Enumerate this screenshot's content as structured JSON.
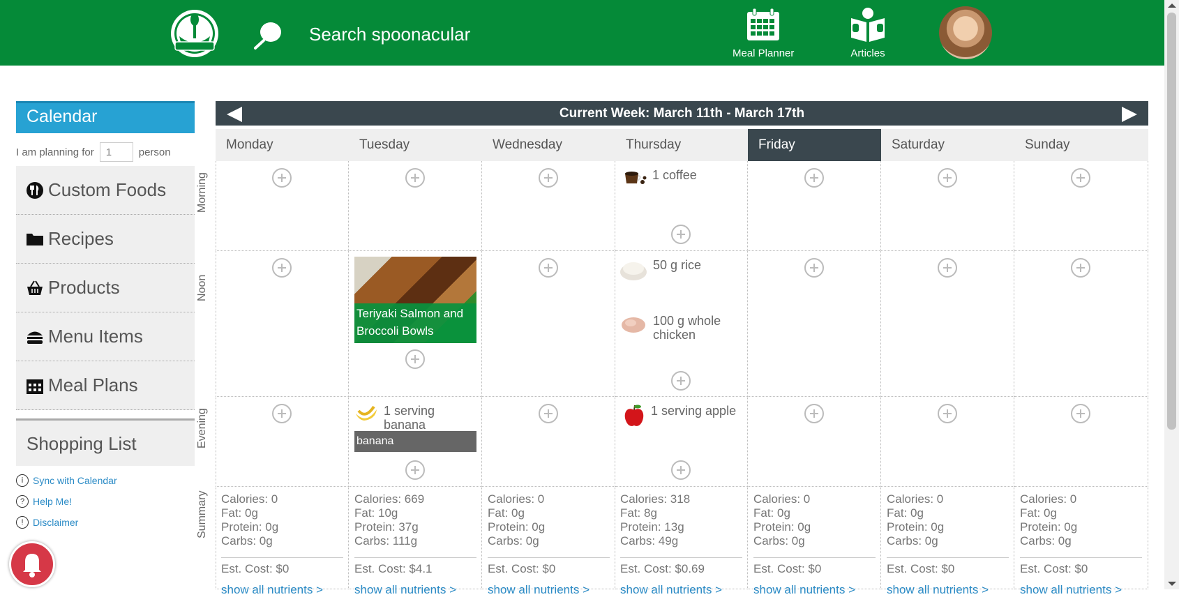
{
  "header": {
    "search_placeholder": "Search spoonacular",
    "nav": [
      {
        "label": "Meal Planner",
        "icon": "calendar-icon"
      },
      {
        "label": "Articles",
        "icon": "book-reader-icon"
      }
    ],
    "colors": {
      "brand": "#058a38",
      "accent": "#27a2d3"
    }
  },
  "sidebar": {
    "calendar_label": "Calendar",
    "planning_prefix": "I am planning for",
    "planning_value": "1",
    "planning_suffix": "person",
    "items": [
      {
        "label": "Custom Foods",
        "icon": "fork-knife-icon"
      },
      {
        "label": "Recipes",
        "icon": "folder-icon"
      },
      {
        "label": "Products",
        "icon": "basket-icon"
      },
      {
        "label": "Menu Items",
        "icon": "burger-icon"
      },
      {
        "label": "Meal Plans",
        "icon": "calendar-icon"
      }
    ],
    "shopping_list": "Shopping List",
    "links": [
      {
        "label": "Sync with Calendar",
        "icon": "info-icon"
      },
      {
        "label": "Help Me!",
        "icon": "help-icon"
      },
      {
        "label": "Disclaimer",
        "icon": "notice-icon"
      }
    ]
  },
  "week": {
    "title": "Current Week: March 11th - March 17th",
    "days": [
      "Monday",
      "Tuesday",
      "Wednesday",
      "Thursday",
      "Friday",
      "Saturday",
      "Sunday"
    ],
    "active_day": "Friday",
    "row_labels": [
      "Morning",
      "Noon",
      "Evening",
      "Summary"
    ]
  },
  "meals": {
    "thursday_morning": {
      "label": "1 coffee",
      "icon": "coffee-icon"
    },
    "thursday_noon_1": {
      "label": "50 g rice",
      "icon": "rice-icon"
    },
    "thursday_noon_2": {
      "label": "100 g whole chicken",
      "icon": "chicken-icon"
    },
    "thursday_evening": {
      "label": "1 serving apple",
      "icon": "apple-icon"
    },
    "tuesday_noon_recipe": {
      "title": "Teriyaki Salmon and Broccoli Bowls"
    },
    "tuesday_evening": {
      "label": "1 serving banana",
      "icon": "banana-icon",
      "bar_label": "banana"
    }
  },
  "summary": [
    {
      "calories": "Calories: 0",
      "fat": "Fat: 0g",
      "protein": "Protein: 0g",
      "carbs": "Carbs: 0g",
      "cost": "Est. Cost: $0",
      "link": "show all nutrients >"
    },
    {
      "calories": "Calories: 669",
      "fat": "Fat: 10g",
      "protein": "Protein: 37g",
      "carbs": "Carbs: 111g",
      "cost": "Est. Cost: $4.1",
      "link": "show all nutrients >"
    },
    {
      "calories": "Calories: 0",
      "fat": "Fat: 0g",
      "protein": "Protein: 0g",
      "carbs": "Carbs: 0g",
      "cost": "Est. Cost: $0",
      "link": "show all nutrients >"
    },
    {
      "calories": "Calories: 318",
      "fat": "Fat: 8g",
      "protein": "Protein: 13g",
      "carbs": "Carbs: 49g",
      "cost": "Est. Cost: $0.69",
      "link": "show all nutrients >"
    },
    {
      "calories": "Calories: 0",
      "fat": "Fat: 0g",
      "protein": "Protein: 0g",
      "carbs": "Carbs: 0g",
      "cost": "Est. Cost: $0",
      "link": "show all nutrients >"
    },
    {
      "calories": "Calories: 0",
      "fat": "Fat: 0g",
      "protein": "Protein: 0g",
      "carbs": "Carbs: 0g",
      "cost": "Est. Cost: $0",
      "link": "show all nutrients >"
    },
    {
      "calories": "Calories: 0",
      "fat": "Fat: 0g",
      "protein": "Protein: 0g",
      "carbs": "Carbs: 0g",
      "cost": "Est. Cost: $0",
      "link": "show all nutrients >"
    }
  ]
}
